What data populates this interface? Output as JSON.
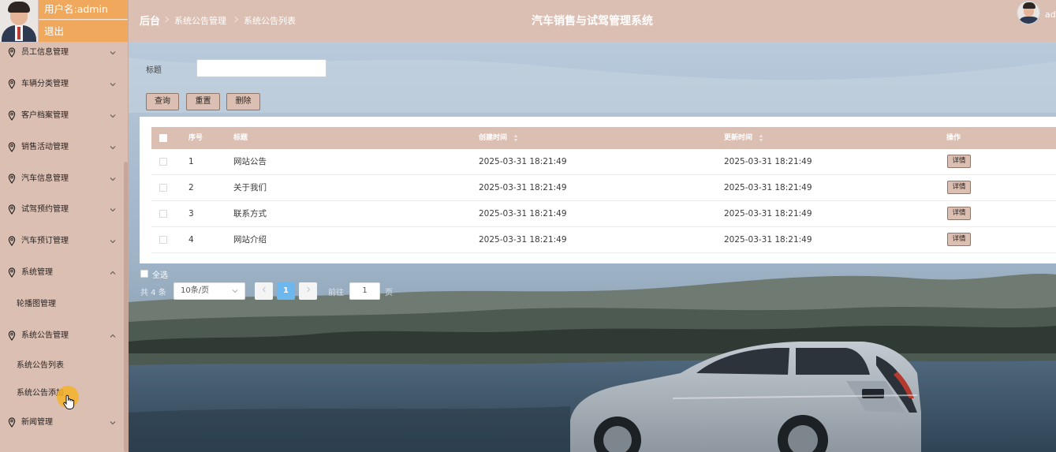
{
  "profile": {
    "username_text": "用户名:admin",
    "logout_label": "退出"
  },
  "sidebar": {
    "menu": [
      {
        "label": "员工信息管理",
        "expanded": false
      },
      {
        "label": "车辆分类管理",
        "expanded": false
      },
      {
        "label": "客户档案管理",
        "expanded": false
      },
      {
        "label": "销售活动管理",
        "expanded": false
      },
      {
        "label": "汽车信息管理",
        "expanded": false
      },
      {
        "label": "试驾预约管理",
        "expanded": false
      },
      {
        "label": "汽车预订管理",
        "expanded": false
      },
      {
        "label": "系统管理",
        "expanded": true,
        "children": [
          "轮播图管理"
        ]
      },
      {
        "label": "系统公告管理",
        "expanded": true,
        "children": [
          "系统公告列表",
          "系统公告添加"
        ]
      },
      {
        "label": "新闻管理",
        "expanded": false
      }
    ]
  },
  "header": {
    "breadcrumb": [
      "后台",
      "系统公告管理",
      "系统公告列表"
    ],
    "app_title": "汽车销售与试驾管理系统",
    "user_short": "adm"
  },
  "search": {
    "label": "标题",
    "value": "",
    "placeholder": ""
  },
  "toolbar": {
    "query_label": "查询",
    "reset_label": "重置",
    "delete_label": "删除"
  },
  "table": {
    "columns": {
      "index": "序号",
      "title": "标题",
      "created": "创建时间",
      "updated": "更新时间",
      "actions": "操作"
    },
    "rows": [
      {
        "index": "1",
        "title": "网站公告",
        "created": "2025-03-31 18:21:49",
        "updated": "2025-03-31 18:21:49",
        "action": "详情"
      },
      {
        "index": "2",
        "title": "关于我们",
        "created": "2025-03-31 18:21:49",
        "updated": "2025-03-31 18:21:49",
        "action": "详情"
      },
      {
        "index": "3",
        "title": "联系方式",
        "created": "2025-03-31 18:21:49",
        "updated": "2025-03-31 18:21:49",
        "action": "详情"
      },
      {
        "index": "4",
        "title": "网站介绍",
        "created": "2025-03-31 18:21:49",
        "updated": "2025-03-31 18:21:49",
        "action": "详情"
      }
    ]
  },
  "footer": {
    "select_all_label": "全选",
    "total_text": "共 4 条",
    "page_size": "10条/页",
    "current_page": "1",
    "goto_label": "前往",
    "goto_value": "1",
    "page_unit": "页"
  },
  "colors": {
    "theme": "#dbbfb3",
    "accent_orange": "#f0a85c",
    "pager_active": "#6db7ef"
  },
  "icons": {
    "menu_item": "location-pin-icon",
    "collapsed": "chevron-down-icon",
    "expanded": "chevron-up-icon",
    "sort": "sort-caret-icon",
    "cursor": "hand-pointer-icon"
  }
}
